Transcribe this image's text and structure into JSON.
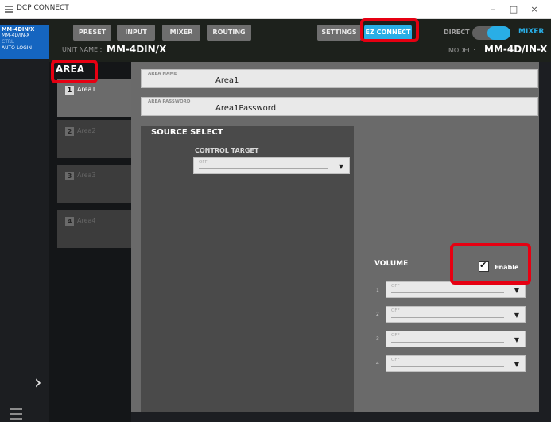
{
  "window": {
    "title": "DCP CONNECT",
    "minimize_glyph": "–",
    "maximize_glyph": "□",
    "close_glyph": "×"
  },
  "device_list": [
    "MM-4DIN/X",
    "MM-4D/IN-X",
    "CTRL ··········",
    "AUTO-LOGIN"
  ],
  "header": {
    "tabs": [
      "PRESET",
      "INPUT",
      "MIXER",
      "ROUTING",
      "SETTINGS",
      "EZ CONNECT"
    ],
    "unit_name_label": "UNIT NAME :",
    "unit_name": "MM-4DIN/X",
    "direct_label": "DIRECT",
    "mixer_label": "MIXER",
    "model_label": "MODEL :",
    "model_value": "MM-4D/IN-X",
    "mode_toggle_on_mixer": true
  },
  "area": {
    "heading": "AREA",
    "items": [
      {
        "number": "1",
        "name": "Area1",
        "active": true
      },
      {
        "number": "2",
        "name": "Area2",
        "active": false
      },
      {
        "number": "3",
        "name": "Area3",
        "active": false
      },
      {
        "number": "4",
        "name": "Area4",
        "active": false
      }
    ]
  },
  "fields": {
    "area_name_label": "AREA NAME",
    "area_name": "Area1",
    "area_password_label": "AREA PASSWORD",
    "area_password": "Area1Password"
  },
  "source_select": {
    "title": "SOURCE SELECT",
    "control_target_label": "CONTROL TARGET",
    "control_target_value": "OFF"
  },
  "volume": {
    "label": "VOLUME",
    "enable_label": "Enable",
    "enable_checked": true,
    "rows": [
      {
        "number": "1",
        "value": "OFF"
      },
      {
        "number": "2",
        "value": "OFF"
      },
      {
        "number": "3",
        "value": "OFF"
      },
      {
        "number": "4",
        "value": "OFF"
      }
    ]
  },
  "icons": {
    "dropdown_arrow": "▼",
    "nav_arrow": "›"
  },
  "colors": {
    "accent": "#29aee6",
    "device_highlight": "#1565c0",
    "callout": "#e60012"
  }
}
